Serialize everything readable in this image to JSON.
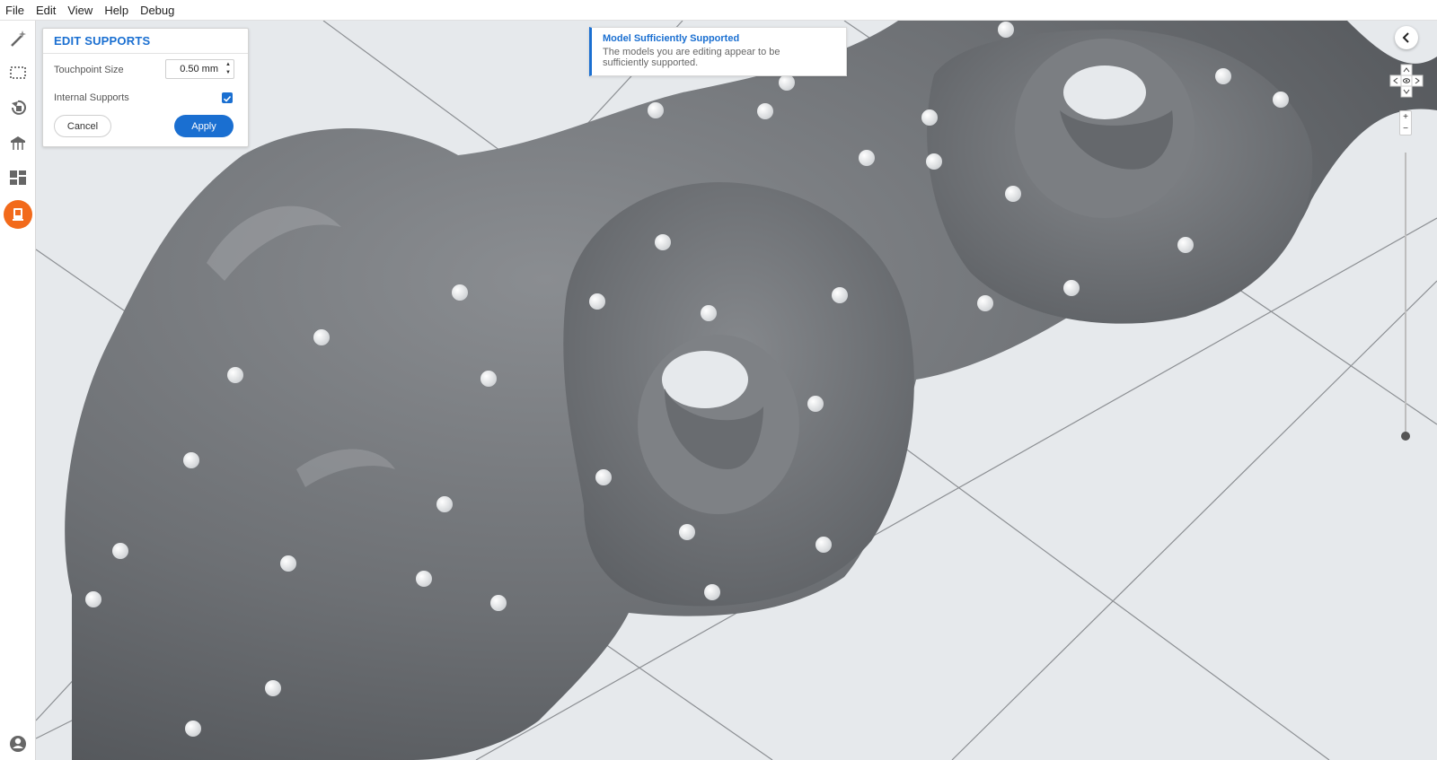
{
  "menu": {
    "file": "File",
    "edit": "Edit",
    "view": "View",
    "help": "Help",
    "debug": "Debug"
  },
  "toolbar": {
    "tools": [
      {
        "name": "magic-wand-icon"
      },
      {
        "name": "select-box-icon"
      },
      {
        "name": "orient-icon"
      },
      {
        "name": "supports-icon"
      },
      {
        "name": "layout-icon"
      },
      {
        "name": "print-icon",
        "active": true
      }
    ],
    "account_icon": "account-icon"
  },
  "edit_supports": {
    "title": "EDIT SUPPORTS",
    "touchpoint_label": "Touchpoint Size",
    "touchpoint_value": "0.50 mm",
    "internal_supports_label": "Internal Supports",
    "internal_supports_checked": true,
    "cancel_label": "Cancel",
    "apply_label": "Apply"
  },
  "notification": {
    "title": "Model Sufficiently Supported",
    "body": "The models you are editing appear to be sufficiently supported."
  },
  "navigation": {
    "zoom_in": "+",
    "zoom_out": "−"
  },
  "colors": {
    "accent": "#1a6fd1",
    "active_tool": "#f26a1b",
    "model": "#6b6e72",
    "background": "#e6e9ec"
  }
}
